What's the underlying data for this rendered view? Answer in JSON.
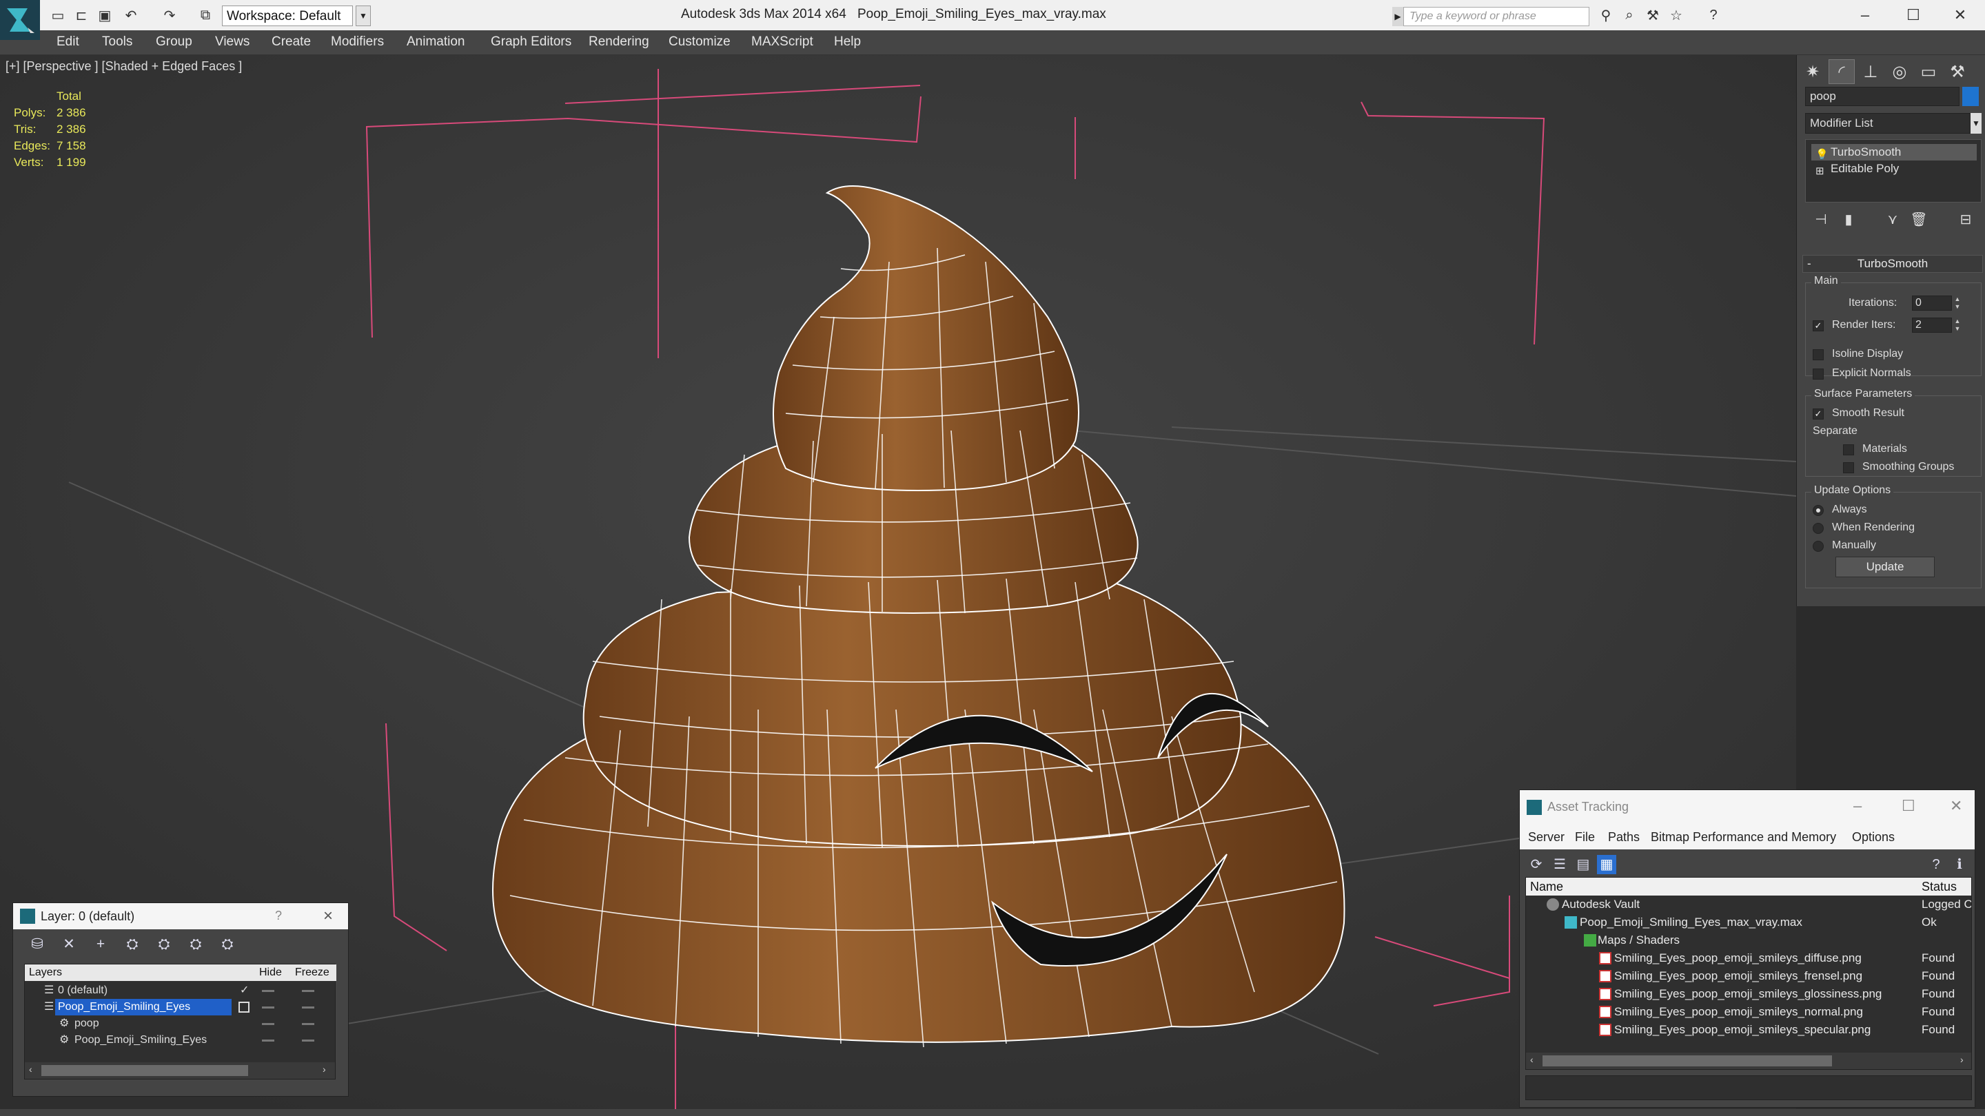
{
  "titlebar": {
    "app_title": "Autodesk 3ds Max  2014 x64",
    "file_title": "Poop_Emoji_Smiling_Eyes_max_vray.max",
    "workspace": "Workspace: Default",
    "search_placeholder": "Type a keyword or phrase"
  },
  "menu": [
    "Edit",
    "Tools",
    "Group",
    "Views",
    "Create",
    "Modifiers",
    "Animation",
    "Graph Editors",
    "Rendering",
    "Customize",
    "MAXScript",
    "Help"
  ],
  "viewport": {
    "label": "[+] [Perspective ] [Shaded + Edged Faces ]",
    "stats": {
      "header": "Total",
      "rows": [
        {
          "key": "Polys:",
          "value": "2 386"
        },
        {
          "key": "Tris:",
          "value": "2 386"
        },
        {
          "key": "Edges:",
          "value": "7 158"
        },
        {
          "key": "Verts:",
          "value": "1 199"
        }
      ]
    },
    "model_color": "#8c5628",
    "wire_color": "#ffffff",
    "bbox_color": "#d84a7a"
  },
  "command_panel": {
    "object_name": "poop",
    "object_color": "#1e74d0",
    "modifier_list": "Modifier List",
    "stack": [
      "TurboSmooth",
      "Editable Poly"
    ],
    "rollout": {
      "title": "TurboSmooth",
      "main_group": "Main",
      "iterations_label": "Iterations:",
      "iterations_value": "0",
      "render_iters_label": "Render Iters:",
      "render_iters_value": "2",
      "isoline": "Isoline Display",
      "explicit_normals": "Explicit Normals",
      "surface_group": "Surface Parameters",
      "smooth_result": "Smooth Result",
      "separate": "Separate",
      "materials": "Materials",
      "smoothing_groups": "Smoothing Groups",
      "update_group": "Update Options",
      "always": "Always",
      "when_rendering": "When Rendering",
      "manually": "Manually",
      "update_button": "Update"
    }
  },
  "layer_dialog": {
    "title": "Layer: 0 (default)",
    "help": "?",
    "columns": {
      "layers": "Layers",
      "hide": "Hide",
      "freeze": "Freeze"
    },
    "rows": [
      {
        "name": "0 (default)"
      },
      {
        "name": "Poop_Emoji_Smiling_Eyes"
      },
      {
        "name": "poop"
      },
      {
        "name": "Poop_Emoji_Smiling_Eyes"
      }
    ]
  },
  "asset_dialog": {
    "title": "Asset Tracking",
    "menu": [
      "Server",
      "File",
      "Paths",
      "Bitmap Performance and Memory",
      "Options"
    ],
    "columns": {
      "name": "Name",
      "status": "Status"
    },
    "rows": [
      {
        "name": "Autodesk Vault",
        "status": "Logged C"
      },
      {
        "name": "Poop_Emoji_Smiling_Eyes_max_vray.max",
        "status": "Ok"
      },
      {
        "name": "Maps / Shaders",
        "status": ""
      },
      {
        "name": "Smiling_Eyes_poop_emoji_smileys_diffuse.png",
        "status": "Found"
      },
      {
        "name": "Smiling_Eyes_poop_emoji_smileys_frensel.png",
        "status": "Found"
      },
      {
        "name": "Smiling_Eyes_poop_emoji_smileys_glossiness.png",
        "status": "Found"
      },
      {
        "name": "Smiling_Eyes_poop_emoji_smileys_normal.png",
        "status": "Found"
      },
      {
        "name": "Smiling_Eyes_poop_emoji_smileys_specular.png",
        "status": "Found"
      }
    ]
  }
}
